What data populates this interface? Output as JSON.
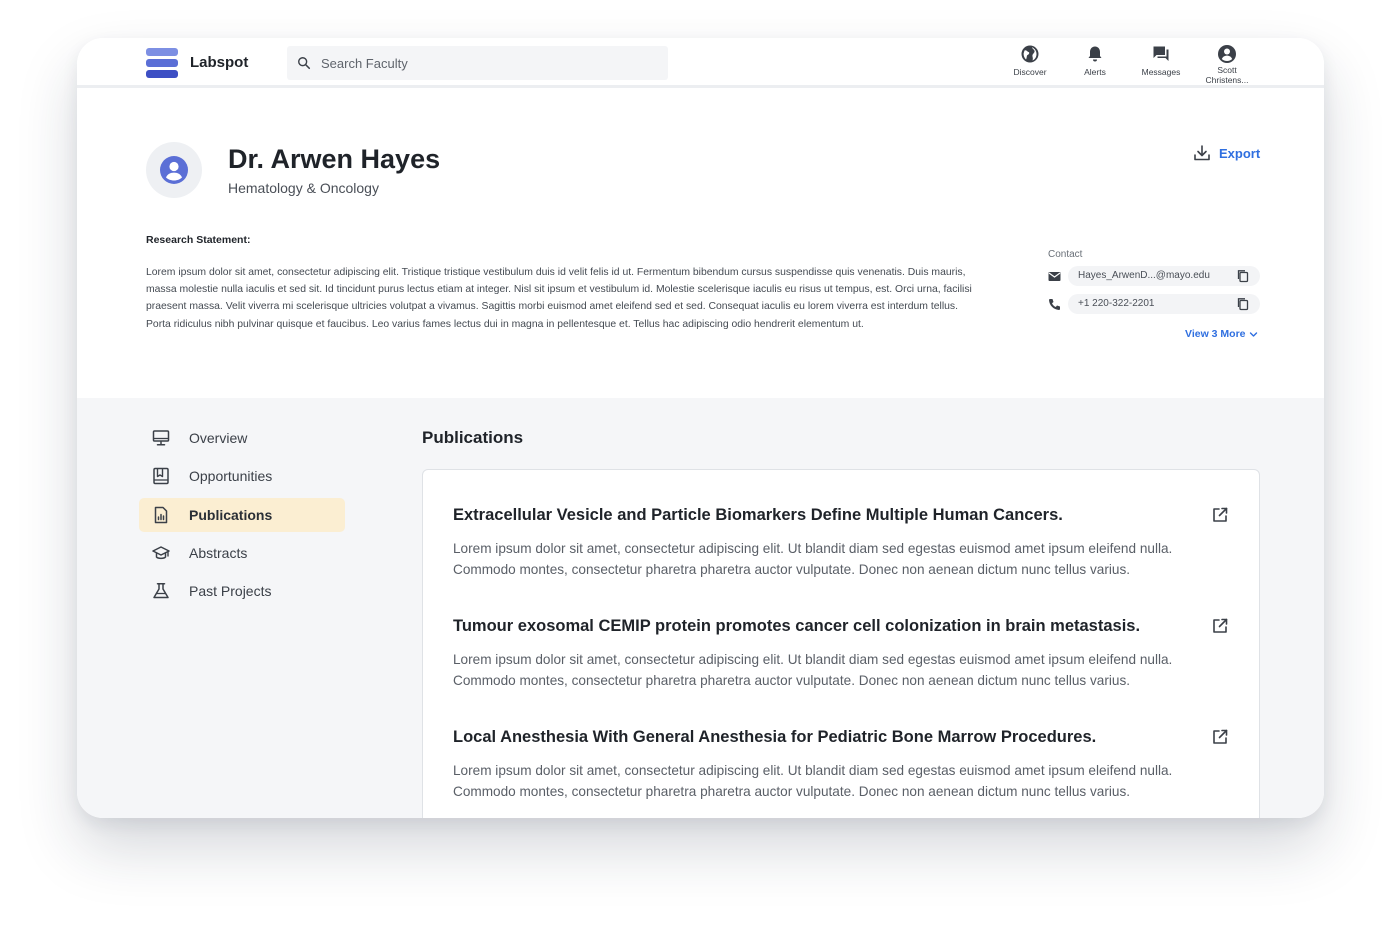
{
  "app": {
    "brand": "Labspot",
    "colors": {
      "accent": "#2f6fe0",
      "active_nav_bg": "#fbeed2",
      "logo": "#5b6fd6"
    }
  },
  "search": {
    "placeholder": "Search Faculty",
    "value": ""
  },
  "topnav": [
    {
      "label": "Discover",
      "icon": "globe-icon"
    },
    {
      "label": "Alerts",
      "icon": "bell-icon"
    },
    {
      "label": "Messages",
      "icon": "chat-icon"
    },
    {
      "label": "Scott Christens...",
      "icon": "user-circle-icon"
    }
  ],
  "profile": {
    "name": "Dr. Arwen Hayes",
    "department": "Hematology & Oncology",
    "export_label": "Export",
    "research_label": "Research Statement:",
    "research_text": "Lorem ipsum dolor sit amet, consectetur adipiscing elit. Tristique tristique vestibulum duis id velit felis id ut. Fermentum bibendum cursus suspendisse quis venenatis. Duis mauris, massa molestie nulla iaculis et sed sit. Id tincidunt purus lectus etiam at integer. Nisl sit ipsum et vestibulum id. Molestie scelerisque iaculis eu risus ut tempus, est. Orci urna, facilisi praesent massa. Velit viverra mi scelerisque ultricies volutpat a vivamus. Sagittis morbi euismod amet eleifend sed et sed. Consequat iaculis eu lorem viverra est interdum tellus. Porta ridiculus nibh pulvinar quisque et faucibus. Leo varius fames lectus dui in magna in pellentesque et. Tellus hac adipiscing odio hendrerit elementum ut."
  },
  "contact": {
    "label": "Contact",
    "email": "Hayes_ArwenD...@mayo.edu",
    "phone": "+1 220-322-2201",
    "view_more": "View 3 More"
  },
  "sidebar": {
    "items": [
      {
        "label": "Overview",
        "icon": "monitor-icon",
        "active": false
      },
      {
        "label": "Opportunities",
        "icon": "book-icon",
        "active": false
      },
      {
        "label": "Publications",
        "icon": "document-chart-icon",
        "active": true
      },
      {
        "label": "Abstracts",
        "icon": "graduation-cap-icon",
        "active": false
      },
      {
        "label": "Past Projects",
        "icon": "flask-icon",
        "active": false
      }
    ]
  },
  "publications": {
    "heading": "Publications",
    "items": [
      {
        "title": "Extracellular Vesicle and Particle Biomarkers Define Multiple Human Cancers.",
        "description": "Lorem ipsum dolor sit amet, consectetur adipiscing elit. Ut blandit diam sed egestas euismod amet ipsum eleifend nulla. Commodo montes, consectetur pharetra pharetra auctor vulputate. Donec non aenean dictum nunc tellus varius."
      },
      {
        "title": "Tumour exosomal CEMIP protein promotes cancer cell colonization in brain metastasis.",
        "description": "Lorem ipsum dolor sit amet, consectetur adipiscing elit. Ut blandit diam sed egestas euismod amet ipsum eleifend nulla. Commodo montes, consectetur pharetra pharetra auctor vulputate. Donec non aenean dictum nunc tellus varius."
      },
      {
        "title": "Local Anesthesia With General Anesthesia for Pediatric Bone Marrow Procedures.",
        "description": "Lorem ipsum dolor sit amet, consectetur adipiscing elit. Ut blandit diam sed egestas euismod amet ipsum eleifend nulla. Commodo montes, consectetur pharetra pharetra auctor vulputate. Donec non aenean dictum nunc tellus varius."
      }
    ]
  }
}
